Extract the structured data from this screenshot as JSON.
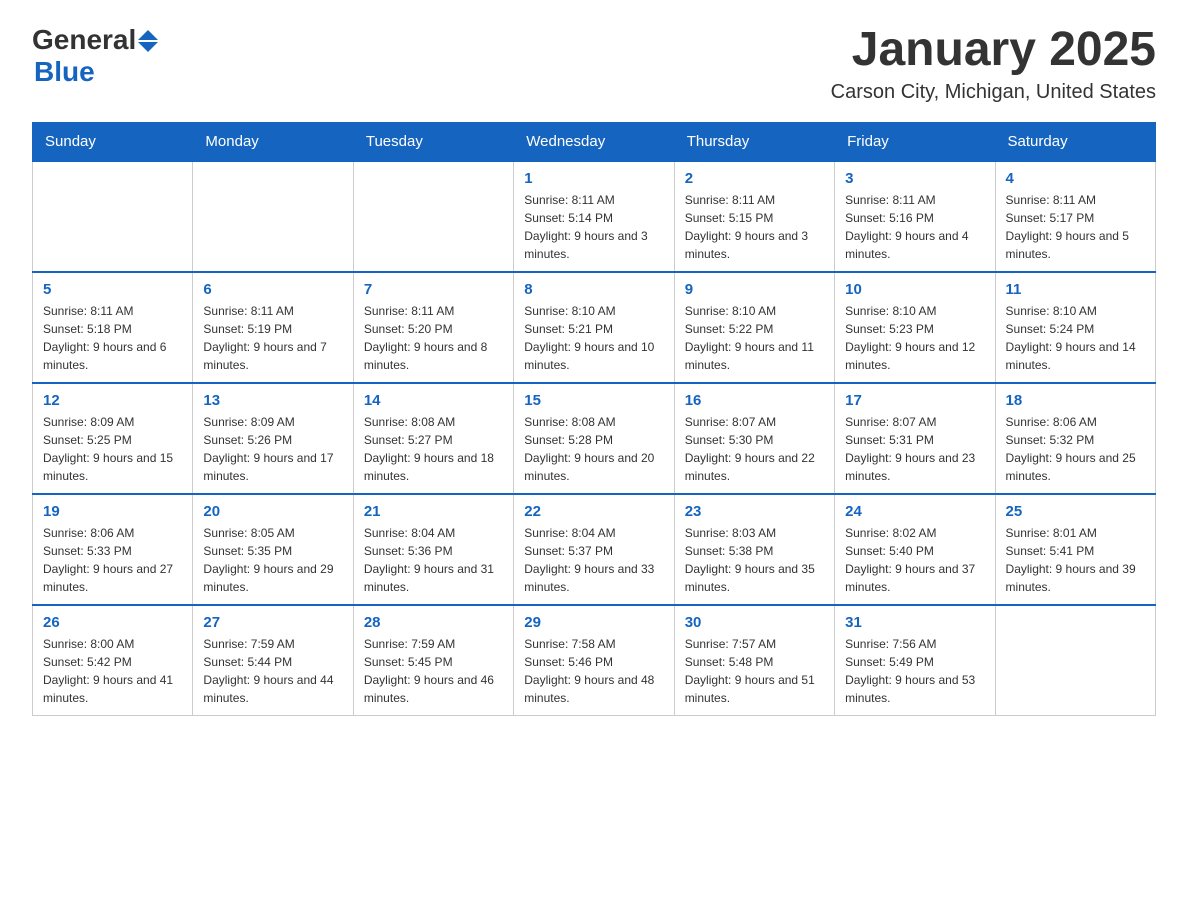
{
  "header": {
    "logo_general": "General",
    "logo_blue": "Blue",
    "title": "January 2025",
    "subtitle": "Carson City, Michigan, United States"
  },
  "weekdays": [
    "Sunday",
    "Monday",
    "Tuesday",
    "Wednesday",
    "Thursday",
    "Friday",
    "Saturday"
  ],
  "weeks": [
    [
      {
        "day": "",
        "info": ""
      },
      {
        "day": "",
        "info": ""
      },
      {
        "day": "",
        "info": ""
      },
      {
        "day": "1",
        "info": "Sunrise: 8:11 AM\nSunset: 5:14 PM\nDaylight: 9 hours and 3 minutes."
      },
      {
        "day": "2",
        "info": "Sunrise: 8:11 AM\nSunset: 5:15 PM\nDaylight: 9 hours and 3 minutes."
      },
      {
        "day": "3",
        "info": "Sunrise: 8:11 AM\nSunset: 5:16 PM\nDaylight: 9 hours and 4 minutes."
      },
      {
        "day": "4",
        "info": "Sunrise: 8:11 AM\nSunset: 5:17 PM\nDaylight: 9 hours and 5 minutes."
      }
    ],
    [
      {
        "day": "5",
        "info": "Sunrise: 8:11 AM\nSunset: 5:18 PM\nDaylight: 9 hours and 6 minutes."
      },
      {
        "day": "6",
        "info": "Sunrise: 8:11 AM\nSunset: 5:19 PM\nDaylight: 9 hours and 7 minutes."
      },
      {
        "day": "7",
        "info": "Sunrise: 8:11 AM\nSunset: 5:20 PM\nDaylight: 9 hours and 8 minutes."
      },
      {
        "day": "8",
        "info": "Sunrise: 8:10 AM\nSunset: 5:21 PM\nDaylight: 9 hours and 10 minutes."
      },
      {
        "day": "9",
        "info": "Sunrise: 8:10 AM\nSunset: 5:22 PM\nDaylight: 9 hours and 11 minutes."
      },
      {
        "day": "10",
        "info": "Sunrise: 8:10 AM\nSunset: 5:23 PM\nDaylight: 9 hours and 12 minutes."
      },
      {
        "day": "11",
        "info": "Sunrise: 8:10 AM\nSunset: 5:24 PM\nDaylight: 9 hours and 14 minutes."
      }
    ],
    [
      {
        "day": "12",
        "info": "Sunrise: 8:09 AM\nSunset: 5:25 PM\nDaylight: 9 hours and 15 minutes."
      },
      {
        "day": "13",
        "info": "Sunrise: 8:09 AM\nSunset: 5:26 PM\nDaylight: 9 hours and 17 minutes."
      },
      {
        "day": "14",
        "info": "Sunrise: 8:08 AM\nSunset: 5:27 PM\nDaylight: 9 hours and 18 minutes."
      },
      {
        "day": "15",
        "info": "Sunrise: 8:08 AM\nSunset: 5:28 PM\nDaylight: 9 hours and 20 minutes."
      },
      {
        "day": "16",
        "info": "Sunrise: 8:07 AM\nSunset: 5:30 PM\nDaylight: 9 hours and 22 minutes."
      },
      {
        "day": "17",
        "info": "Sunrise: 8:07 AM\nSunset: 5:31 PM\nDaylight: 9 hours and 23 minutes."
      },
      {
        "day": "18",
        "info": "Sunrise: 8:06 AM\nSunset: 5:32 PM\nDaylight: 9 hours and 25 minutes."
      }
    ],
    [
      {
        "day": "19",
        "info": "Sunrise: 8:06 AM\nSunset: 5:33 PM\nDaylight: 9 hours and 27 minutes."
      },
      {
        "day": "20",
        "info": "Sunrise: 8:05 AM\nSunset: 5:35 PM\nDaylight: 9 hours and 29 minutes."
      },
      {
        "day": "21",
        "info": "Sunrise: 8:04 AM\nSunset: 5:36 PM\nDaylight: 9 hours and 31 minutes."
      },
      {
        "day": "22",
        "info": "Sunrise: 8:04 AM\nSunset: 5:37 PM\nDaylight: 9 hours and 33 minutes."
      },
      {
        "day": "23",
        "info": "Sunrise: 8:03 AM\nSunset: 5:38 PM\nDaylight: 9 hours and 35 minutes."
      },
      {
        "day": "24",
        "info": "Sunrise: 8:02 AM\nSunset: 5:40 PM\nDaylight: 9 hours and 37 minutes."
      },
      {
        "day": "25",
        "info": "Sunrise: 8:01 AM\nSunset: 5:41 PM\nDaylight: 9 hours and 39 minutes."
      }
    ],
    [
      {
        "day": "26",
        "info": "Sunrise: 8:00 AM\nSunset: 5:42 PM\nDaylight: 9 hours and 41 minutes."
      },
      {
        "day": "27",
        "info": "Sunrise: 7:59 AM\nSunset: 5:44 PM\nDaylight: 9 hours and 44 minutes."
      },
      {
        "day": "28",
        "info": "Sunrise: 7:59 AM\nSunset: 5:45 PM\nDaylight: 9 hours and 46 minutes."
      },
      {
        "day": "29",
        "info": "Sunrise: 7:58 AM\nSunset: 5:46 PM\nDaylight: 9 hours and 48 minutes."
      },
      {
        "day": "30",
        "info": "Sunrise: 7:57 AM\nSunset: 5:48 PM\nDaylight: 9 hours and 51 minutes."
      },
      {
        "day": "31",
        "info": "Sunrise: 7:56 AM\nSunset: 5:49 PM\nDaylight: 9 hours and 53 minutes."
      },
      {
        "day": "",
        "info": ""
      }
    ]
  ]
}
